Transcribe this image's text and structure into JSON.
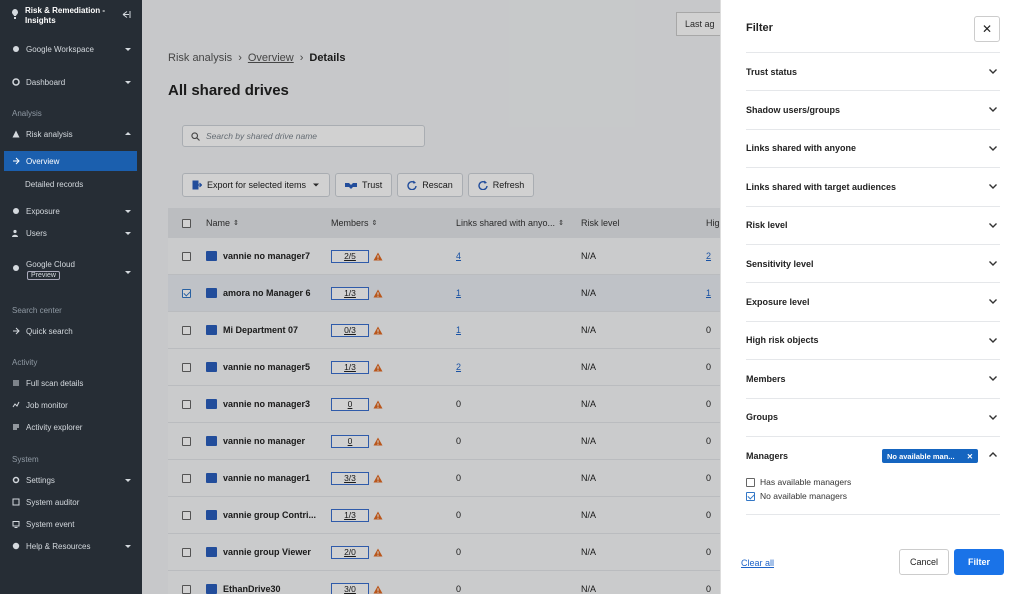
{
  "app": {
    "title": "Risk & Remediation - Insights"
  },
  "sidebar": {
    "workspace": "Google Workspace",
    "dashboard": "Dashboard",
    "section_analysis": "Analysis",
    "risk_analysis": "Risk analysis",
    "overview": "Overview",
    "detailed_records": "Detailed records",
    "exposure": "Exposure",
    "users": "Users",
    "google_cloud": "Google Cloud",
    "preview": "Preview",
    "section_search": "Search center",
    "quick_search": "Quick search",
    "section_activity": "Activity",
    "full_scan": "Full scan details",
    "job_monitor": "Job monitor",
    "activity_explorer": "Activity explorer",
    "section_system": "System",
    "settings": "Settings",
    "system_auditor": "System auditor",
    "system_event": "System event",
    "help": "Help & Resources"
  },
  "header": {
    "last_ag": "Last ag"
  },
  "breadcrumb": {
    "root": "Risk analysis",
    "mid": "Overview",
    "current": "Details"
  },
  "page": {
    "title": "All shared drives"
  },
  "search": {
    "placeholder": "Search by shared drive name"
  },
  "toolbar": {
    "export": "Export for selected items",
    "trust": "Trust",
    "rescan": "Rescan",
    "refresh": "Refresh"
  },
  "table": {
    "headers": {
      "name": "Name",
      "members": "Members",
      "links": "Links shared with anyo...",
      "risk": "Risk level",
      "hig": "Hig"
    },
    "rows": [
      {
        "name": "vannie no manager7",
        "members": "2/5",
        "links": "4",
        "risk": "N/A",
        "hig": "2",
        "checked": false
      },
      {
        "name": "amora no Manager 6",
        "members": "1/3",
        "links": "1",
        "risk": "N/A",
        "hig": "1",
        "checked": true
      },
      {
        "name": "Mi Department 07",
        "members": "0/3",
        "links": "1",
        "risk": "N/A",
        "hig": "0",
        "checked": false
      },
      {
        "name": "vannie no manager5",
        "members": "1/3",
        "links": "2",
        "risk": "N/A",
        "hig": "0",
        "checked": false
      },
      {
        "name": "vannie no manager3",
        "members": "0",
        "links": "0",
        "risk": "N/A",
        "hig": "0",
        "checked": false
      },
      {
        "name": "vannie no manager",
        "members": "0",
        "links": "0",
        "risk": "N/A",
        "hig": "0",
        "checked": false
      },
      {
        "name": "vannie no manager1",
        "members": "3/3",
        "links": "0",
        "risk": "N/A",
        "hig": "0",
        "checked": false
      },
      {
        "name": "vannie group Contri...",
        "members": "1/3",
        "links": "0",
        "risk": "N/A",
        "hig": "0",
        "checked": false
      },
      {
        "name": "vannie group Viewer",
        "members": "2/0",
        "links": "0",
        "risk": "N/A",
        "hig": "0",
        "checked": false
      },
      {
        "name": "EthanDrive30",
        "members": "3/0",
        "links": "0",
        "risk": "N/A",
        "hig": "0",
        "checked": false
      }
    ]
  },
  "filter": {
    "title": "Filter",
    "sections": [
      "Trust status",
      "Shadow users/groups",
      "Links shared with anyone",
      "Links shared with target audiences",
      "Risk level",
      "Sensitivity level",
      "Exposure level",
      "High risk objects",
      "Members",
      "Groups"
    ],
    "managers": {
      "label": "Managers",
      "chip": "No available man...",
      "options": [
        {
          "label": "Has available managers",
          "checked": false
        },
        {
          "label": "No available managers",
          "checked": true
        }
      ]
    },
    "clear_all": "Clear all",
    "cancel": "Cancel",
    "apply": "Filter"
  },
  "colors": {
    "sidebar_bg": "#262d35",
    "active_nav": "#1b5fae",
    "primary": "#1a73e8",
    "warning": "#e26a21"
  }
}
